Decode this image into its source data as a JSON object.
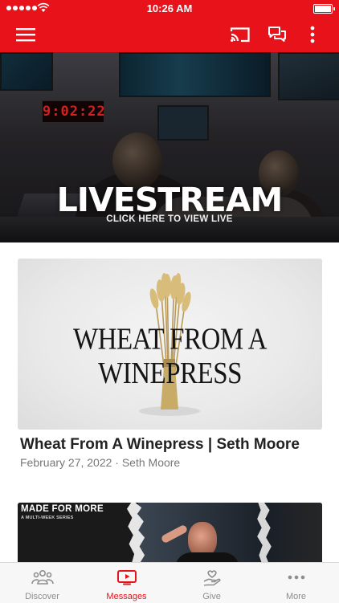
{
  "status_bar": {
    "time": "10:26 AM"
  },
  "app_bar": {
    "accent_color": "#e8121a",
    "icons": [
      "menu-icon",
      "cast-icon",
      "chat-icon",
      "more-vertical-icon"
    ]
  },
  "hero": {
    "title": "LIVESTREAM",
    "subtitle": "CLICK HERE TO VIEW LIVE",
    "clock_display": "9:02:22"
  },
  "featured": {
    "art_text": "WHEAT FROM A WINEPRESS",
    "title": "Wheat From A Winepress | Seth Moore",
    "meta": "February 27, 2022 · Seth Moore"
  },
  "next_card": {
    "art_title": "MADE FOR MORE",
    "art_subtitle": "A MULTI-WEEK SERIES"
  },
  "tabs": [
    {
      "label": "Discover",
      "icon": "people-icon",
      "active": false
    },
    {
      "label": "Messages",
      "icon": "tv-icon",
      "active": true
    },
    {
      "label": "Give",
      "icon": "give-hand-heart-icon",
      "active": false
    },
    {
      "label": "More",
      "icon": "more-dots-icon",
      "active": false
    }
  ]
}
